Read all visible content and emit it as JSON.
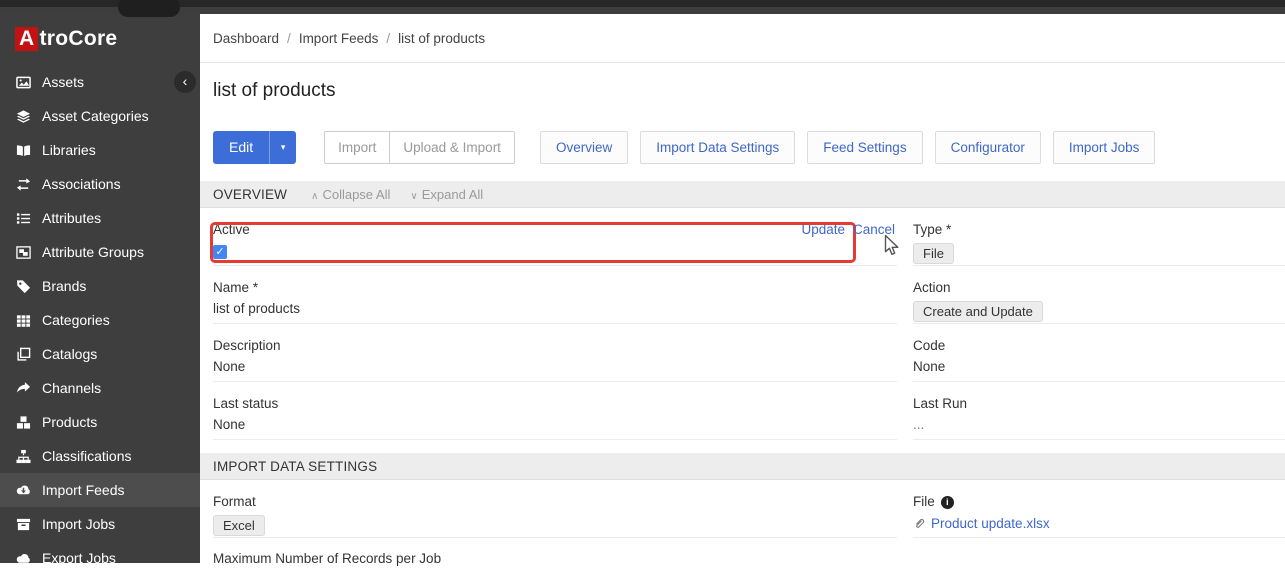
{
  "colors": {
    "accent_blue": "#3d6dd6",
    "link_blue": "#3f67c8",
    "sidebar_bg": "#3e3e3e",
    "sidebar_active_bg": "#4d4d4d",
    "logo_red": "#c31212",
    "annotation_red": "#e63b35",
    "checkbox_blue": "#4285f4",
    "panel_header_bg": "#ededed"
  },
  "icons": {
    "info": "i",
    "check": "✓",
    "caret_down": "▾",
    "collapse_chevron": "∧",
    "expand_chevron": "∨",
    "sidebar_collapse_chevron": "‹"
  },
  "sidebar": {
    "logo": {
      "letter": "A",
      "rest": "troCore"
    },
    "items": [
      {
        "label": "Assets"
      },
      {
        "label": "Asset Categories"
      },
      {
        "label": "Libraries"
      },
      {
        "label": "Associations"
      },
      {
        "label": "Attributes"
      },
      {
        "label": "Attribute Groups"
      },
      {
        "label": "Brands"
      },
      {
        "label": "Categories"
      },
      {
        "label": "Catalogs"
      },
      {
        "label": "Channels"
      },
      {
        "label": "Products"
      },
      {
        "label": "Classifications"
      },
      {
        "label": "Import Feeds",
        "active": true
      },
      {
        "label": "Import Jobs"
      },
      {
        "label": "Export Jobs"
      }
    ]
  },
  "breadcrumb": {
    "dashboard": "Dashboard",
    "import_feeds": "Import Feeds",
    "current": "list of products",
    "separator": "/"
  },
  "page": {
    "title": "list of products"
  },
  "toolbar": {
    "edit_label": "Edit",
    "import_label": "Import",
    "upload_import_label": "Upload & Import",
    "tabs": [
      {
        "label": "Overview"
      },
      {
        "label": "Import Data Settings"
      },
      {
        "label": "Feed Settings"
      },
      {
        "label": "Configurator"
      },
      {
        "label": "Import Jobs"
      }
    ]
  },
  "overview_panel": {
    "title": "OVERVIEW",
    "collapse_all": "Collapse All",
    "expand_all": "Expand All",
    "active_field": {
      "label": "Active",
      "checked": true,
      "update_label": "Update",
      "cancel_label": "Cancel"
    },
    "type_field": {
      "label": "Type *",
      "value": "File"
    },
    "name_field": {
      "label": "Name *",
      "value": "list of products"
    },
    "action_field": {
      "label": "Action",
      "value": "Create and Update"
    },
    "description_field": {
      "label": "Description",
      "value": "None"
    },
    "code_field": {
      "label": "Code",
      "value": "None"
    },
    "last_status_field": {
      "label": "Last status",
      "value": "None"
    },
    "last_run_field": {
      "label": "Last Run",
      "value": "..."
    }
  },
  "import_settings_panel": {
    "title": "IMPORT DATA SETTINGS",
    "format_field": {
      "label": "Format",
      "value": "Excel"
    },
    "file_field": {
      "label": "File",
      "value": "Product update.xlsx"
    },
    "max_records_field": {
      "label": "Maximum Number of Records per Job"
    }
  }
}
